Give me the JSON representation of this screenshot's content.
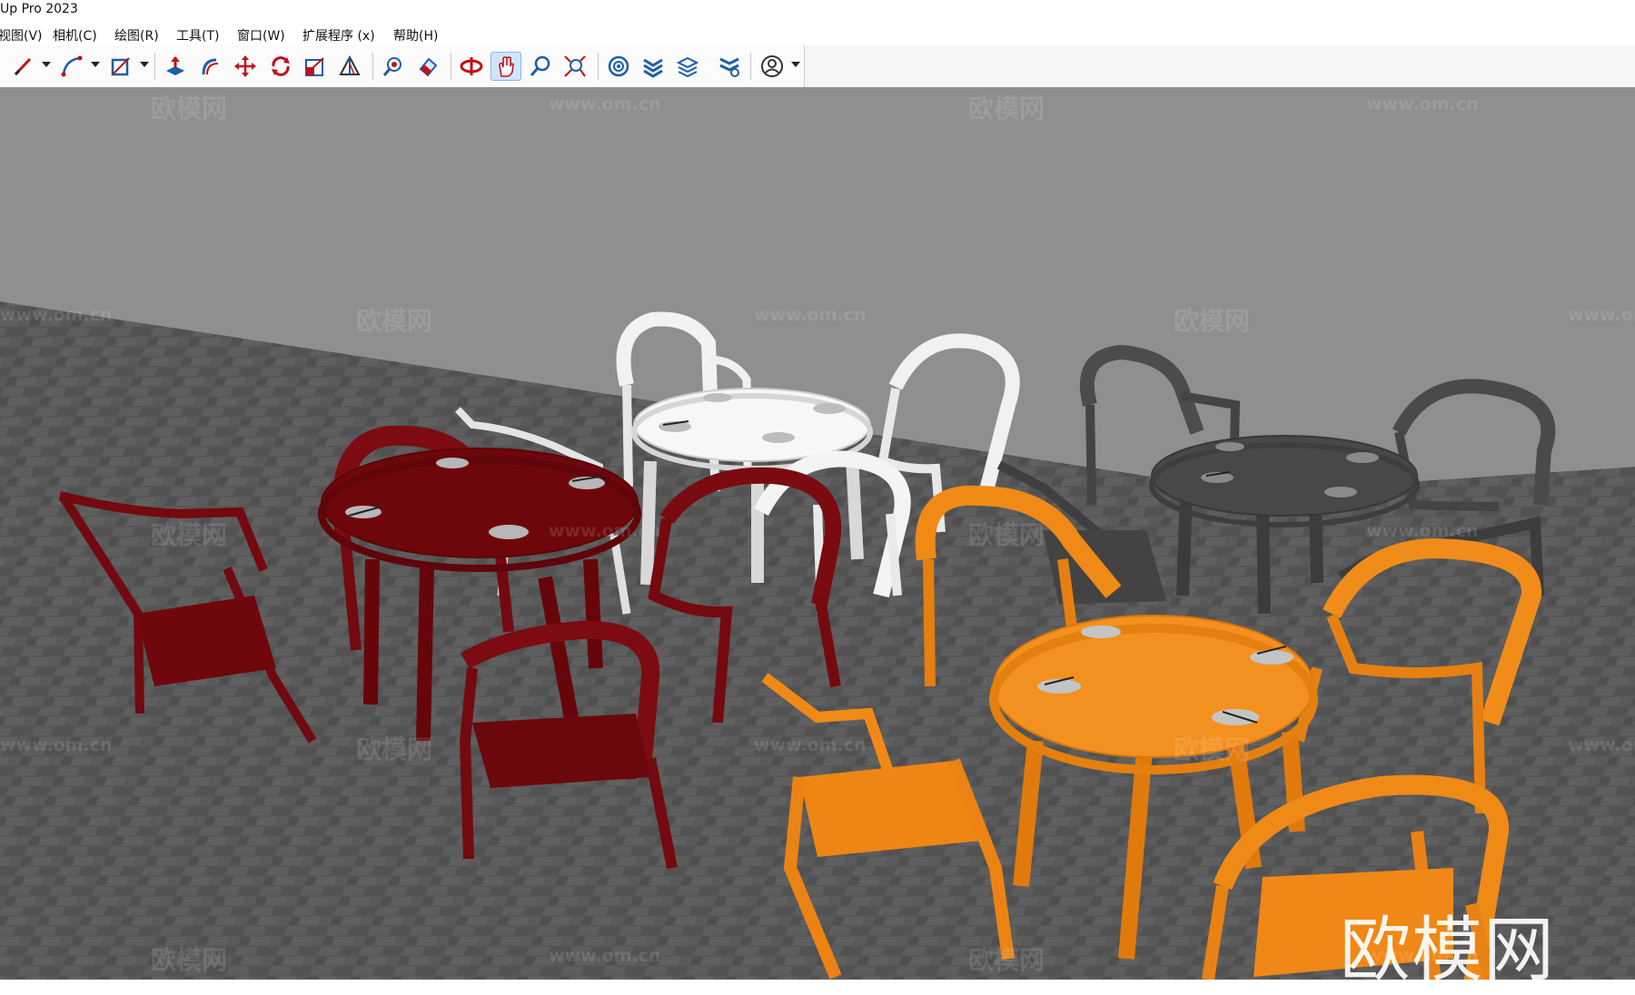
{
  "app": {
    "title": "Up Pro 2023"
  },
  "menu": [
    {
      "label": "视图(V)"
    },
    {
      "label": "相机(C)"
    },
    {
      "label": "绘图(R)"
    },
    {
      "label": "工具(T)"
    },
    {
      "label": "窗口(W)"
    },
    {
      "label": "扩展程序 (x)"
    },
    {
      "label": "帮助(H)"
    }
  ],
  "toolbar": {
    "tools": [
      {
        "icon": "pencil-icon"
      },
      {
        "icon": "arc-icon"
      },
      {
        "icon": "rectangle-icon"
      },
      {
        "icon": "push-pull-icon"
      },
      {
        "icon": "follow-me-icon"
      },
      {
        "icon": "move-icon"
      },
      {
        "icon": "rotate-icon"
      },
      {
        "icon": "scale-icon"
      },
      {
        "icon": "tape-measure-icon"
      },
      {
        "icon": "paint-bucket-icon"
      },
      {
        "icon": "eraser-icon"
      },
      {
        "icon": "orbit-icon"
      },
      {
        "icon": "pan-icon",
        "active": true
      },
      {
        "icon": "zoom-icon"
      },
      {
        "icon": "zoom-extents-icon"
      },
      {
        "icon": "model-info-icon"
      },
      {
        "icon": "layers-icon"
      },
      {
        "icon": "components-icon"
      },
      {
        "icon": "styles-icon"
      },
      {
        "icon": "account-icon"
      }
    ]
  },
  "viewport": {
    "watermark_text": "欧模网",
    "watermark_url": "www.om.cn",
    "brand_mark": "欧模网",
    "wall_color": "#8f8f8f",
    "floor_color": "#555555",
    "furniture_sets": [
      {
        "name": "red",
        "color": "#7a0b10"
      },
      {
        "name": "white",
        "color": "#f2f2f2"
      },
      {
        "name": "gray",
        "color": "#4d4d4d"
      },
      {
        "name": "orange",
        "color": "#f08a17"
      }
    ]
  }
}
